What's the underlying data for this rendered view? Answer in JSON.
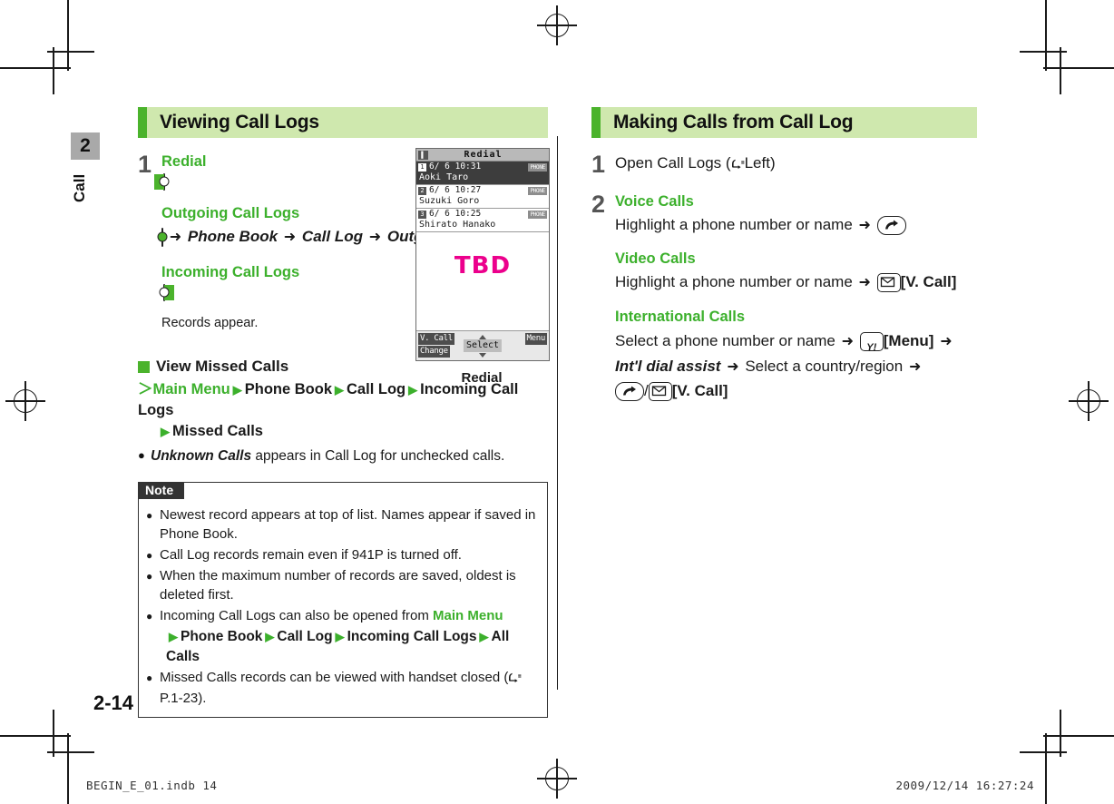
{
  "chapter": {
    "number": "2",
    "label": "Call"
  },
  "page_number": "2-14",
  "footer": {
    "file": "BEGIN_E_01.indb     14",
    "timestamp": "2009/12/14     16:27:24"
  },
  "left_column": {
    "section_title": "Viewing Call Logs",
    "step1": {
      "number": "1",
      "redial_title": "Redial",
      "redial_key_icon": "key-right-green-icon",
      "outgoing_title": "Outgoing Call Logs",
      "outgoing_key_icon": "key-center-dot-icon",
      "outgoing_path": {
        "arrow1": "➜",
        "item1": "Phone Book",
        "arrow2": "➜",
        "item2": "Call Log",
        "arrow3": "➜",
        "item3": "Outgoing Call Logs"
      },
      "incoming_title": "Incoming Call Logs",
      "incoming_key_icon": "key-left-green-icon",
      "result_text": "Records appear."
    },
    "subsection": {
      "heading": "View Missed Calls",
      "path_prefix": "＞",
      "path_items": [
        "Main Menu",
        "Phone Book",
        "Call Log",
        "Incoming Call Logs",
        "Missed Calls"
      ],
      "bullet": {
        "term": "Unknown Calls",
        "rest": " appears in Call Log for unchecked calls."
      }
    },
    "note": {
      "label": "Note",
      "items": [
        "Newest record appears at top of list. Names appear if saved in Phone Book.",
        "Call Log records remain even if 941P is turned off.",
        "When the maximum number of records are saved, oldest is deleted first."
      ],
      "item4_prefix": "Incoming Call Logs can also be opened from ",
      "item4_link": "Main Menu",
      "item4_path": [
        "Phone Book",
        "Call Log",
        "Incoming Call Logs",
        "All Calls"
      ],
      "item5_prefix": "Missed Calls records can be viewed with handset closed (",
      "item5_ref": "P.1-23",
      "item5_suffix": ")."
    }
  },
  "phone_screen": {
    "status_signal_icon": "signal-icon",
    "title": "Redial",
    "rows": [
      {
        "index": "1",
        "datetime": "6/ 6 10:31",
        "badge": "PHONE",
        "name": "Aoki Taro",
        "selected": true
      },
      {
        "index": "2",
        "datetime": "6/ 6 10:27",
        "badge": "PHONE",
        "name": "Suzuki Goro",
        "selected": false
      },
      {
        "index": "3",
        "datetime": "6/ 6 10:25",
        "badge": "PHONE",
        "name": "Shirato Hanako",
        "selected": false
      }
    ],
    "placeholder": "TBD",
    "softkey_left_top": "V. Call",
    "softkey_left_bottom": "Change",
    "softkey_center": "Select",
    "softkey_right": "Menu",
    "caption": "Redial"
  },
  "right_column": {
    "section_title": "Making Calls from Call Log",
    "step1": {
      "number": "1",
      "text_prefix": "Open Call Logs (",
      "ref": "Left",
      "text_suffix": ")"
    },
    "step2": {
      "number": "2",
      "voice": {
        "title": "Voice Calls",
        "text": "Highlight a phone number or name",
        "arrow": "➜",
        "key_icon": "call-key-icon"
      },
      "video": {
        "title": "Video Calls",
        "text": "Highlight a phone number or name",
        "arrow": "➜",
        "key_icon": "mail-key-icon",
        "key_label": "[V. Call]"
      },
      "international": {
        "title": "International Calls",
        "text1": "Select a phone number or name",
        "arrow1": "➜",
        "key1_icon": "yahoo-key-icon",
        "key1_label": "[Menu]",
        "arrow2": "➜",
        "menu_item": "Int'l dial assist",
        "arrow3": "➜",
        "text2": "Select a country/region",
        "arrow4": "➜",
        "key2_icon": "call-key-icon",
        "slash": "/",
        "key3_icon": "mail-key-icon",
        "key3_label": "[V. Call]"
      }
    }
  },
  "colors": {
    "accent_green": "#3cb02c",
    "band_green": "#cfe8ae",
    "bar_green": "#4bb32c",
    "magenta": "#ec008c",
    "chapter_grey": "#a9a9a9"
  }
}
